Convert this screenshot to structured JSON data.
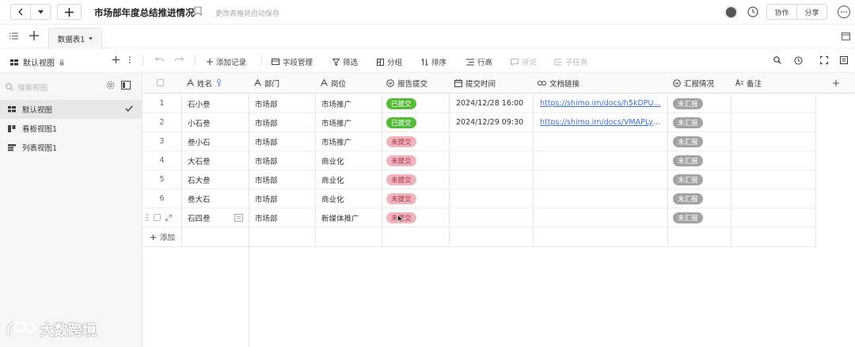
{
  "app": {
    "title": "市场部年度总结推进情况",
    "autosave_text": "更改表格将自动保存",
    "collaborate_label": "协作",
    "share_label": "分享"
  },
  "tabs": {
    "sheet_label": "数据表1"
  },
  "toolbar": {
    "view_label": "默认视图",
    "add_record": "添加记录",
    "field_manage": "字段管理",
    "filter": "筛选",
    "group": "分组",
    "sort": "排序",
    "row_height": "行高",
    "comment": "评论",
    "subtask": "子任务"
  },
  "sidebar": {
    "search_placeholder": "搜索视图",
    "views": [
      {
        "label": "默认视图",
        "icon": "grid-view-icon",
        "active": true
      },
      {
        "label": "看板视图1",
        "icon": "kanban-view-icon",
        "active": false
      },
      {
        "label": "列表视图1",
        "icon": "list-view-icon",
        "active": false
      }
    ]
  },
  "table": {
    "columns": [
      "姓名",
      "部门",
      "岗位",
      "报告提交",
      "提交时间",
      "文档链接",
      "汇报情况",
      "备注"
    ],
    "rows": [
      {
        "num": "1",
        "name": "石小叁",
        "dept": "市场部",
        "post": "市场推广",
        "status": "已提交",
        "time": "2024/12/28 16:00",
        "link": "https://shimo.im/docs/h5kDPU...",
        "report": "未汇报"
      },
      {
        "num": "2",
        "name": "小石叁",
        "dept": "市场部",
        "post": "市场推广",
        "status": "已提交",
        "time": "2024/12/29 09:30",
        "link": "https://shimo.im/docs/VMAPLyh...",
        "report": "未汇报"
      },
      {
        "num": "3",
        "name": "叁小石",
        "dept": "市场部",
        "post": "市场推广",
        "status": "未提交",
        "time": "",
        "link": "",
        "report": "未汇报"
      },
      {
        "num": "4",
        "name": "大石叁",
        "dept": "市场部",
        "post": "商业化",
        "status": "未提交",
        "time": "",
        "link": "",
        "report": "未汇报"
      },
      {
        "num": "5",
        "name": "石大叁",
        "dept": "市场部",
        "post": "商业化",
        "status": "未提交",
        "time": "",
        "link": "",
        "report": "未汇报"
      },
      {
        "num": "6",
        "name": "叁大石",
        "dept": "市场部",
        "post": "商业化",
        "status": "未提交",
        "time": "",
        "link": "",
        "report": "未汇报"
      },
      {
        "num": "",
        "name": "石四叁",
        "dept": "市场部",
        "post": "新媒体推广",
        "status": "未提交",
        "time": "",
        "link": "",
        "report": "未汇报"
      }
    ],
    "add_row_label": "添加"
  },
  "watermark": {
    "text": "大数跨境"
  },
  "colors": {
    "submitted": "#55bb38",
    "not_submitted": "#f2b4bc",
    "not_reported": "#a3a3a3",
    "link": "#3a6fd8"
  }
}
